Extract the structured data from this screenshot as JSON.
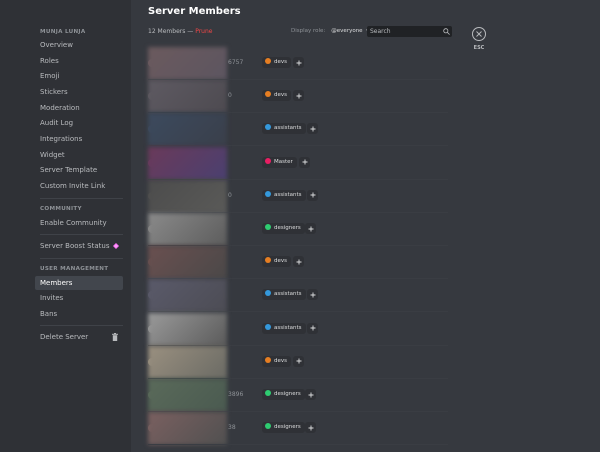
{
  "sidebar": {
    "server_name": "MUNJA LUNJA",
    "items": [
      {
        "label": "Overview"
      },
      {
        "label": "Roles"
      },
      {
        "label": "Emoji"
      },
      {
        "label": "Stickers"
      },
      {
        "label": "Moderation"
      },
      {
        "label": "Audit Log"
      },
      {
        "label": "Integrations"
      },
      {
        "label": "Widget"
      },
      {
        "label": "Server Template"
      },
      {
        "label": "Custom Invite Link"
      }
    ],
    "community_header": "COMMUNITY",
    "enable_community": "Enable Community",
    "boost_status": "Server Boost Status",
    "user_mgmt_header": "USER MANAGEMENT",
    "members": "Members",
    "invites": "Invites",
    "bans": "Bans",
    "delete_server": "Delete Server"
  },
  "header": {
    "title": "Server Members",
    "member_count": "12 Members —",
    "prune": "Prune",
    "display_role_label": "Display role:",
    "display_role_value": "@everyone",
    "search_placeholder": "Search",
    "esc_label": "ESC"
  },
  "members": [
    {
      "partial_text": "6757",
      "role": "devs",
      "role_color": "#e67e22"
    },
    {
      "partial_text": "0",
      "role": "devs",
      "role_color": "#e67e22"
    },
    {
      "partial_text": "",
      "role": "assistants",
      "role_color": "#3498db"
    },
    {
      "partial_text": "",
      "role": "Master",
      "role_color": "#e91e63"
    },
    {
      "partial_text": "0",
      "role": "assistants",
      "role_color": "#3498db"
    },
    {
      "partial_text": "",
      "role": "designers",
      "role_color": "#2ecc71"
    },
    {
      "partial_text": "",
      "role": "devs",
      "role_color": "#e67e22"
    },
    {
      "partial_text": "",
      "role": "assistants",
      "role_color": "#3498db"
    },
    {
      "partial_text": "",
      "role": "assistants",
      "role_color": "#3498db"
    },
    {
      "partial_text": "",
      "role": "devs",
      "role_color": "#e67e22"
    },
    {
      "partial_text": "3896",
      "role": "designers",
      "role_color": "#2ecc71"
    },
    {
      "partial_text": "38",
      "role": "designers",
      "role_color": "#2ecc71"
    }
  ],
  "colors": {
    "prune": "#f04747",
    "boost": "#ff73fa",
    "background": "#36393f",
    "sidebar": "#2f3136"
  }
}
